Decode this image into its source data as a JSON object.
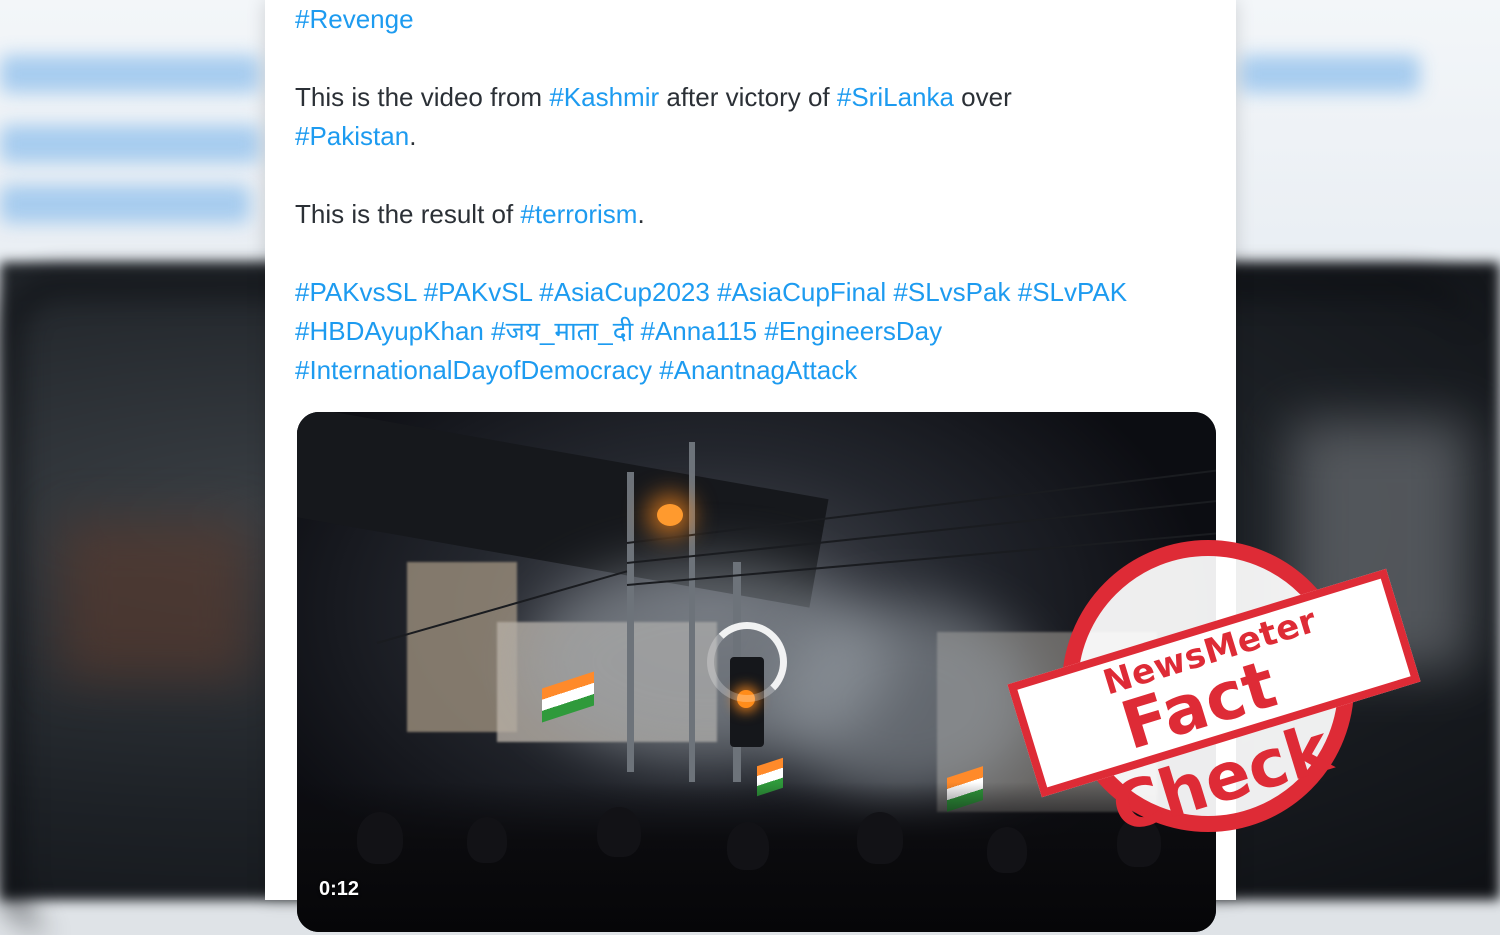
{
  "tweet": {
    "line_revenge": "#Revenge",
    "line2": {
      "text_a": "This is the video from ",
      "tag_kashmir": "#Kashmir",
      "text_b": " after victory of ",
      "tag_srilanka": "#SriLanka",
      "text_c": " over",
      "tag_pakistan": "#Pakistan",
      "text_d": "."
    },
    "line3": {
      "text_a": "This is the result of ",
      "tag_terrorism": "#terrorism",
      "text_b": "."
    },
    "hashtags": [
      [
        "#PAKvsSL",
        "#PAKvSL",
        "#AsiaCup2023",
        "#AsiaCupFinal",
        "#SLvsPak",
        "#SLvPAK"
      ],
      [
        "#HBDAyupKhan",
        "#जय_माता_दी",
        "#Anna115",
        "#EngineersDay"
      ],
      [
        "#InternationalDayofDemocracy",
        "#AnantnagAttack"
      ]
    ]
  },
  "video": {
    "timestamp": "0:12",
    "state": "loading"
  },
  "stamp": {
    "brand": "NewsMeter",
    "title": "Fact Check",
    "color": "#de2b36"
  },
  "colors": {
    "hashtag": "#1d9bf0",
    "text": "#2b3036"
  }
}
